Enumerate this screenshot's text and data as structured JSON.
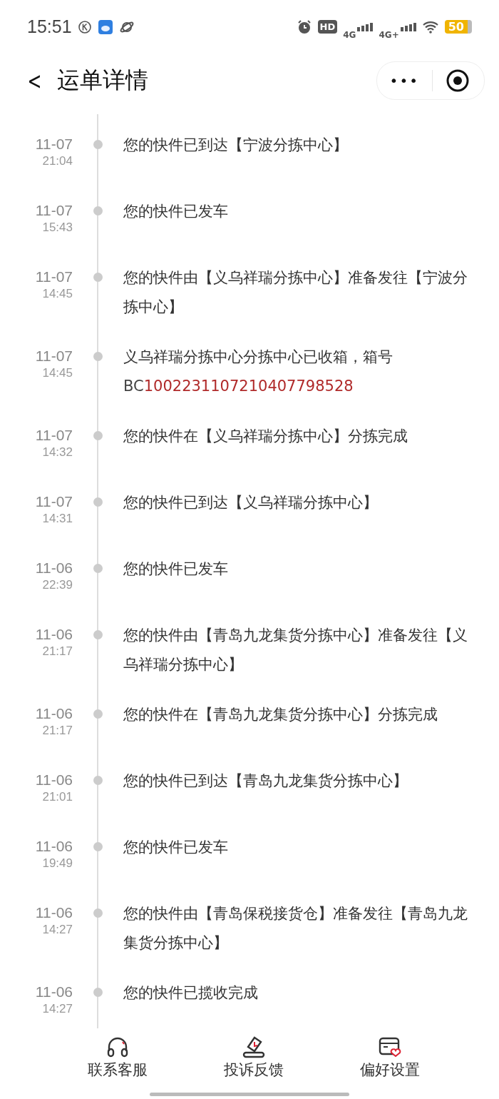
{
  "status_bar": {
    "time": "15:51",
    "hd": "HD",
    "sim1": "4G",
    "sim2": "4G+",
    "battery": "50"
  },
  "header": {
    "back": "<",
    "title": "运单详情",
    "more": "•••"
  },
  "events": [
    {
      "date": "11-07",
      "time": "21:04",
      "text": "您的快件已到达【宁波分拣中心】"
    },
    {
      "date": "11-07",
      "time": "15:43",
      "text": "您的快件已发车"
    },
    {
      "date": "11-07",
      "time": "14:45",
      "text": "您的快件由【义乌祥瑞分拣中心】准备发往【宁波分拣中心】"
    },
    {
      "date": "11-07",
      "time": "14:45",
      "text": "义乌祥瑞分拣中心分拣中心已收箱，箱号",
      "box_prefix": "BC",
      "box_number": "1002231107210407798528"
    },
    {
      "date": "11-07",
      "time": "14:32",
      "text": "您的快件在【义乌祥瑞分拣中心】分拣完成"
    },
    {
      "date": "11-07",
      "time": "14:31",
      "text": "您的快件已到达【义乌祥瑞分拣中心】"
    },
    {
      "date": "11-06",
      "time": "22:39",
      "text": "您的快件已发车"
    },
    {
      "date": "11-06",
      "time": "21:17",
      "text": "您的快件由【青岛九龙集货分拣中心】准备发往【义乌祥瑞分拣中心】"
    },
    {
      "date": "11-06",
      "time": "21:17",
      "text": "您的快件在【青岛九龙集货分拣中心】分拣完成"
    },
    {
      "date": "11-06",
      "time": "21:01",
      "text": "您的快件已到达【青岛九龙集货分拣中心】"
    },
    {
      "date": "11-06",
      "time": "19:49",
      "text": "您的快件已发车"
    },
    {
      "date": "11-06",
      "time": "14:27",
      "text": "您的快件由【青岛保税接货仓】准备发往【青岛九龙集货分拣中心】"
    },
    {
      "date": "11-06",
      "time": "14:27",
      "text": "您的快件已揽收完成"
    }
  ],
  "actions": [
    {
      "kind": "support",
      "label": "联系客服"
    },
    {
      "kind": "complaint",
      "label": "投诉反馈"
    },
    {
      "kind": "preferences",
      "label": "偏好设置"
    }
  ]
}
